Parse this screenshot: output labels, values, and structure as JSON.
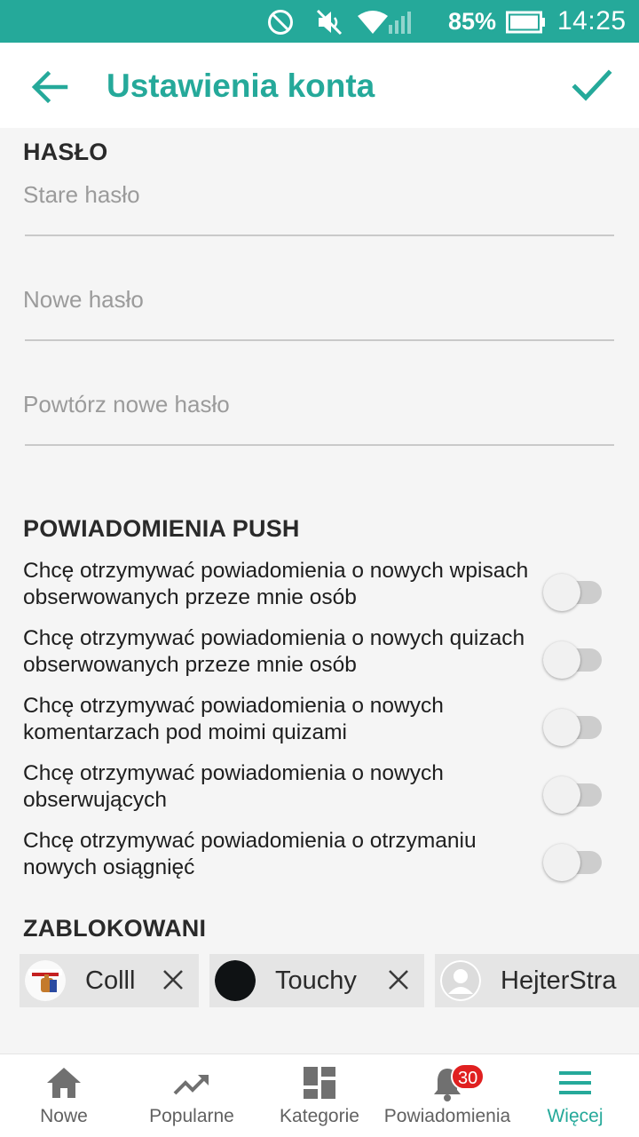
{
  "status_bar": {
    "battery_percent": "85%",
    "time": "14:25",
    "icons": [
      "do-not-disturb-icon",
      "mute-icon",
      "wifi-icon",
      "signal-icon",
      "battery-icon"
    ]
  },
  "app_bar": {
    "title": "Ustawienia konta",
    "back_icon": "arrow-back-icon",
    "confirm_icon": "check-icon",
    "accent_color": "#25a99a"
  },
  "password": {
    "title": "HASŁO",
    "fields": [
      {
        "placeholder": "Stare hasło",
        "value": ""
      },
      {
        "placeholder": "Nowe hasło",
        "value": ""
      },
      {
        "placeholder": "Powtórz nowe hasło",
        "value": ""
      }
    ]
  },
  "push": {
    "title": "POWIADOMIENIA PUSH",
    "items": [
      {
        "label": "Chcę otrzymywać powiadomienia o nowych wpisach obserwowanych przeze mnie osób",
        "enabled": false
      },
      {
        "label": "Chcę otrzymywać powiadomienia o nowych quizach obserwowanych przeze mnie osób",
        "enabled": false
      },
      {
        "label": "Chcę otrzymywać powiadomienia o nowych komentarzach pod moimi quizami",
        "enabled": false
      },
      {
        "label": "Chcę otrzymywać powiadomienia o nowych obserwujących",
        "enabled": false
      },
      {
        "label": "Chcę otrzymywać powiadomienia o otrzymaniu nowych osiągnięć",
        "enabled": false
      }
    ]
  },
  "blocked": {
    "title": "ZABLOKOWANI",
    "users": [
      {
        "name": "Colll",
        "avatar": "custom-avatar"
      },
      {
        "name": "Touchy",
        "avatar": "black-avatar"
      },
      {
        "name": "HejterStra",
        "avatar": "default-avatar"
      }
    ],
    "remove_icon": "close-icon"
  },
  "bottom_nav": {
    "items": [
      {
        "label": "Nowe",
        "icon": "home-icon"
      },
      {
        "label": "Popularne",
        "icon": "trending-up-icon"
      },
      {
        "label": "Kategorie",
        "icon": "dashboard-icon"
      },
      {
        "label": "Powiadomienia",
        "icon": "bell-icon",
        "badge": "30"
      },
      {
        "label": "Więcej",
        "icon": "menu-icon",
        "active": true
      }
    ]
  }
}
